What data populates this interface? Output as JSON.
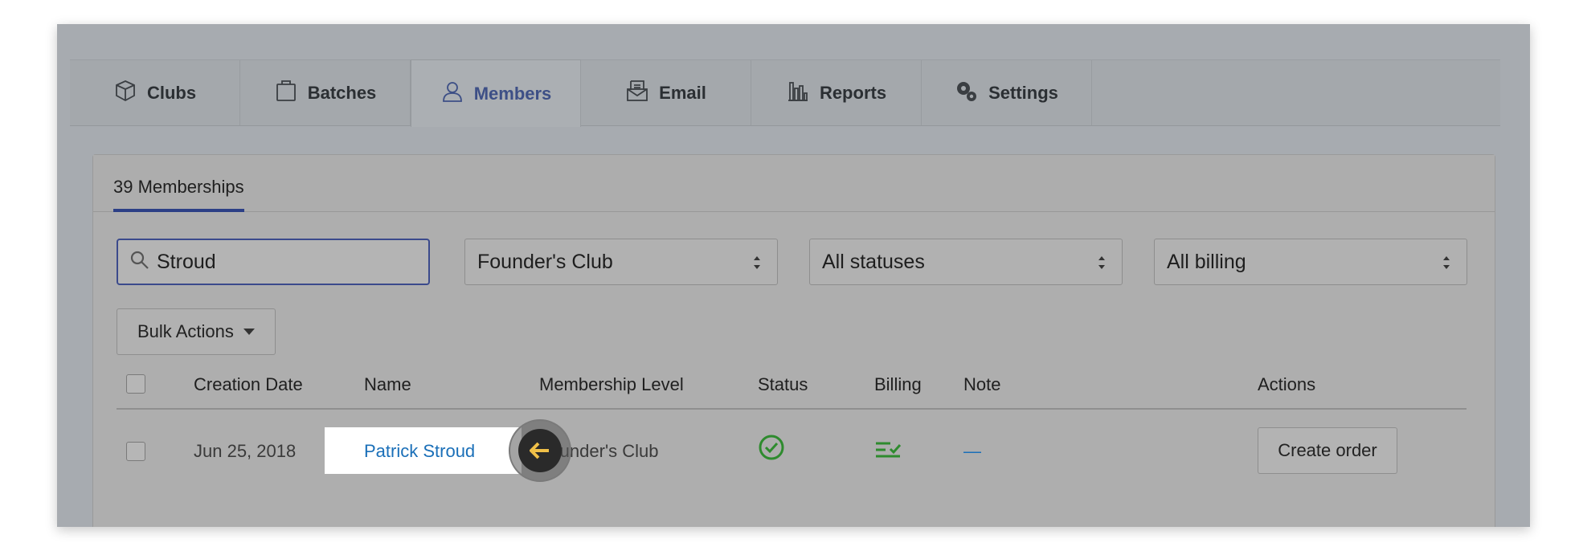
{
  "tabs": [
    {
      "label": "Clubs",
      "icon": "box-icon"
    },
    {
      "label": "Batches",
      "icon": "clipboard-icon"
    },
    {
      "label": "Members",
      "icon": "user-icon",
      "active": true
    },
    {
      "label": "Email",
      "icon": "envelope-icon"
    },
    {
      "label": "Reports",
      "icon": "bar-chart-icon"
    },
    {
      "label": "Settings",
      "icon": "gears-icon"
    }
  ],
  "panel": {
    "count_tab": "39 Memberships"
  },
  "filters": {
    "search_value": "Stroud",
    "club_select": "Founder's Club",
    "status_select": "All statuses",
    "billing_select": "All billing"
  },
  "bulk_actions": "Bulk Actions",
  "table": {
    "headers": {
      "creation_date": "Creation Date",
      "name": "Name",
      "membership_level": "Membership Level",
      "status": "Status",
      "billing": "Billing",
      "note": "Note",
      "actions": "Actions"
    },
    "rows": [
      {
        "creation_date": "Jun 25, 2018",
        "name": "Patrick Stroud",
        "membership_level": "Founder's Club",
        "note": "—",
        "action": "Create order"
      }
    ]
  },
  "colors": {
    "active_tab": "#3d4f86",
    "link": "#1a6fb8",
    "status_ok": "#2e8b2e",
    "cursor_arrow": "#f0c048"
  }
}
